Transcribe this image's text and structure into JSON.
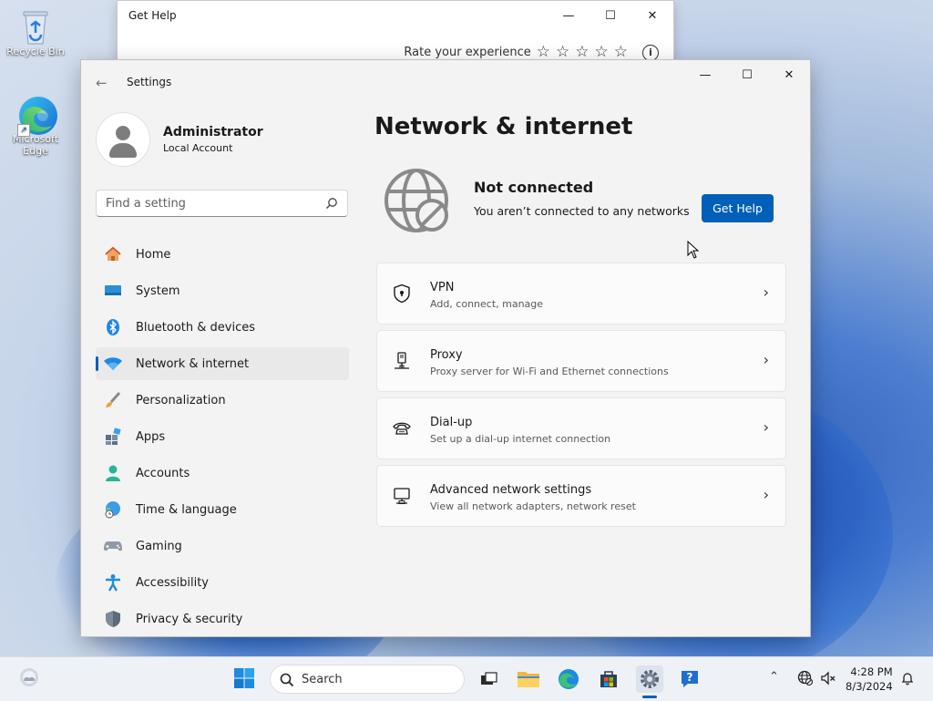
{
  "desktop": {
    "icons": [
      {
        "label": "Recycle Bin"
      },
      {
        "label": "Microsoft Edge"
      }
    ]
  },
  "get_help_window": {
    "title": "Get Help",
    "rate_label": "Rate your experience",
    "stars": [
      "☆",
      "☆",
      "☆",
      "☆",
      "☆"
    ],
    "info_glyph": "i",
    "minimize_glyph": "—",
    "maximize_glyph": "☐",
    "close_glyph": "✕"
  },
  "settings_window": {
    "title": "Settings",
    "back_glyph": "←",
    "minimize_glyph": "—",
    "maximize_glyph": "☐",
    "close_glyph": "✕",
    "profile": {
      "name": "Administrator",
      "account_type": "Local Account"
    },
    "search": {
      "placeholder": "Find a setting"
    },
    "nav": [
      {
        "label": "Home",
        "icon": "home-icon"
      },
      {
        "label": "System",
        "icon": "system-icon"
      },
      {
        "label": "Bluetooth & devices",
        "icon": "bluetooth-icon"
      },
      {
        "label": "Network & internet",
        "icon": "wifi-icon",
        "selected": true
      },
      {
        "label": "Personalization",
        "icon": "brush-icon"
      },
      {
        "label": "Apps",
        "icon": "apps-icon"
      },
      {
        "label": "Accounts",
        "icon": "accounts-icon"
      },
      {
        "label": "Time & language",
        "icon": "globe-clock-icon"
      },
      {
        "label": "Gaming",
        "icon": "gamepad-icon"
      },
      {
        "label": "Accessibility",
        "icon": "accessibility-icon"
      },
      {
        "label": "Privacy & security",
        "icon": "shield-icon"
      }
    ],
    "page_title": "Network & internet",
    "status": {
      "title": "Not connected",
      "subtitle": "You aren’t connected to any networks",
      "button": "Get Help"
    },
    "cards": [
      {
        "title": "VPN",
        "subtitle": "Add, connect, manage",
        "icon": "vpn-shield-icon"
      },
      {
        "title": "Proxy",
        "subtitle": "Proxy server for Wi-Fi and Ethernet connections",
        "icon": "proxy-icon"
      },
      {
        "title": "Dial-up",
        "subtitle": "Set up a dial-up internet connection",
        "icon": "dialup-phone-icon"
      },
      {
        "title": "Advanced network settings",
        "subtitle": "View all network adapters, network reset",
        "icon": "advanced-network-icon"
      }
    ],
    "chevron_glyph": "›"
  },
  "taskbar": {
    "search_label": "Search",
    "tray_chevron_glyph": "⌃",
    "time": "4:28 PM",
    "date": "8/3/2024"
  },
  "colors": {
    "accent": "#005fb8",
    "selected_nav_bg": "#e9e9e9"
  }
}
